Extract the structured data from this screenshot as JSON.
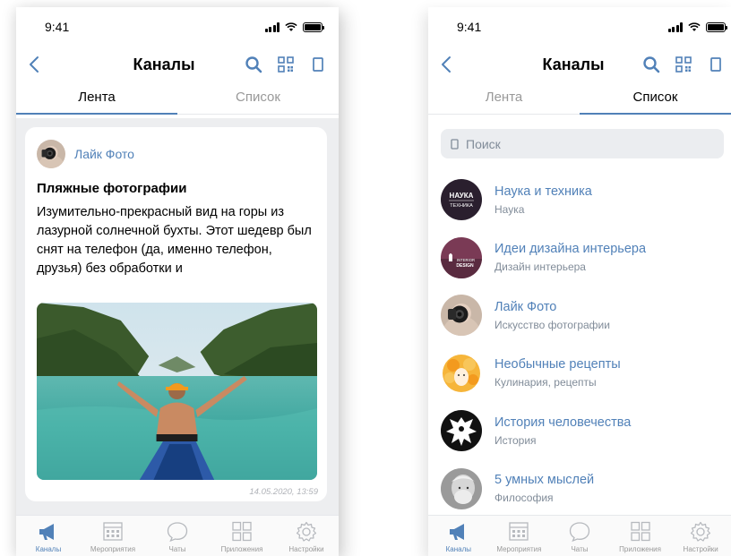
{
  "status": {
    "time": "9:41"
  },
  "header": {
    "title": "Каналы"
  },
  "tabs": [
    "Лента",
    "Список"
  ],
  "feed": {
    "post": {
      "author": "Лайк Фото",
      "title": "Пляжные фотографии",
      "text": "Изумительно-прекрасный вид на горы из лазурной солнечной бухты. Этот шедевр был снят на телефон (да, именно телефон, друзья) без обработки и",
      "date": "14.05.2020, 13:59"
    }
  },
  "list": {
    "search_placeholder": "Поиск",
    "channels": [
      {
        "name": "Наука и техника",
        "category": "Наука",
        "avatar_text": [
          "НАУКА",
          "ТЕХНИКА"
        ]
      },
      {
        "name": "Идеи дизайна интерьера",
        "category": "Дизайн интерьера",
        "avatar_text": [
          "INTERIOR",
          "DESIGN"
        ]
      },
      {
        "name": "Лайк Фото",
        "category": "Искусство фотографии"
      },
      {
        "name": "Необычные рецепты",
        "category": "Кулинария, рецепты"
      },
      {
        "name": "История человечества",
        "category": "История"
      },
      {
        "name": "5 умных мыслей",
        "category": "Философия"
      }
    ]
  },
  "bottom_nav": [
    {
      "label": "Каналы",
      "icon": "megaphone-icon"
    },
    {
      "label": "Мероприятия",
      "icon": "calendar-grid-icon"
    },
    {
      "label": "Чаты",
      "icon": "chat-bubble-icon"
    },
    {
      "label": "Приложения",
      "icon": "apps-grid-icon"
    },
    {
      "label": "Настройки",
      "icon": "gear-icon"
    }
  ],
  "colors": {
    "accent": "#5181b8",
    "feed_bg": "#edeef0",
    "secondary_text": "#818c99"
  }
}
